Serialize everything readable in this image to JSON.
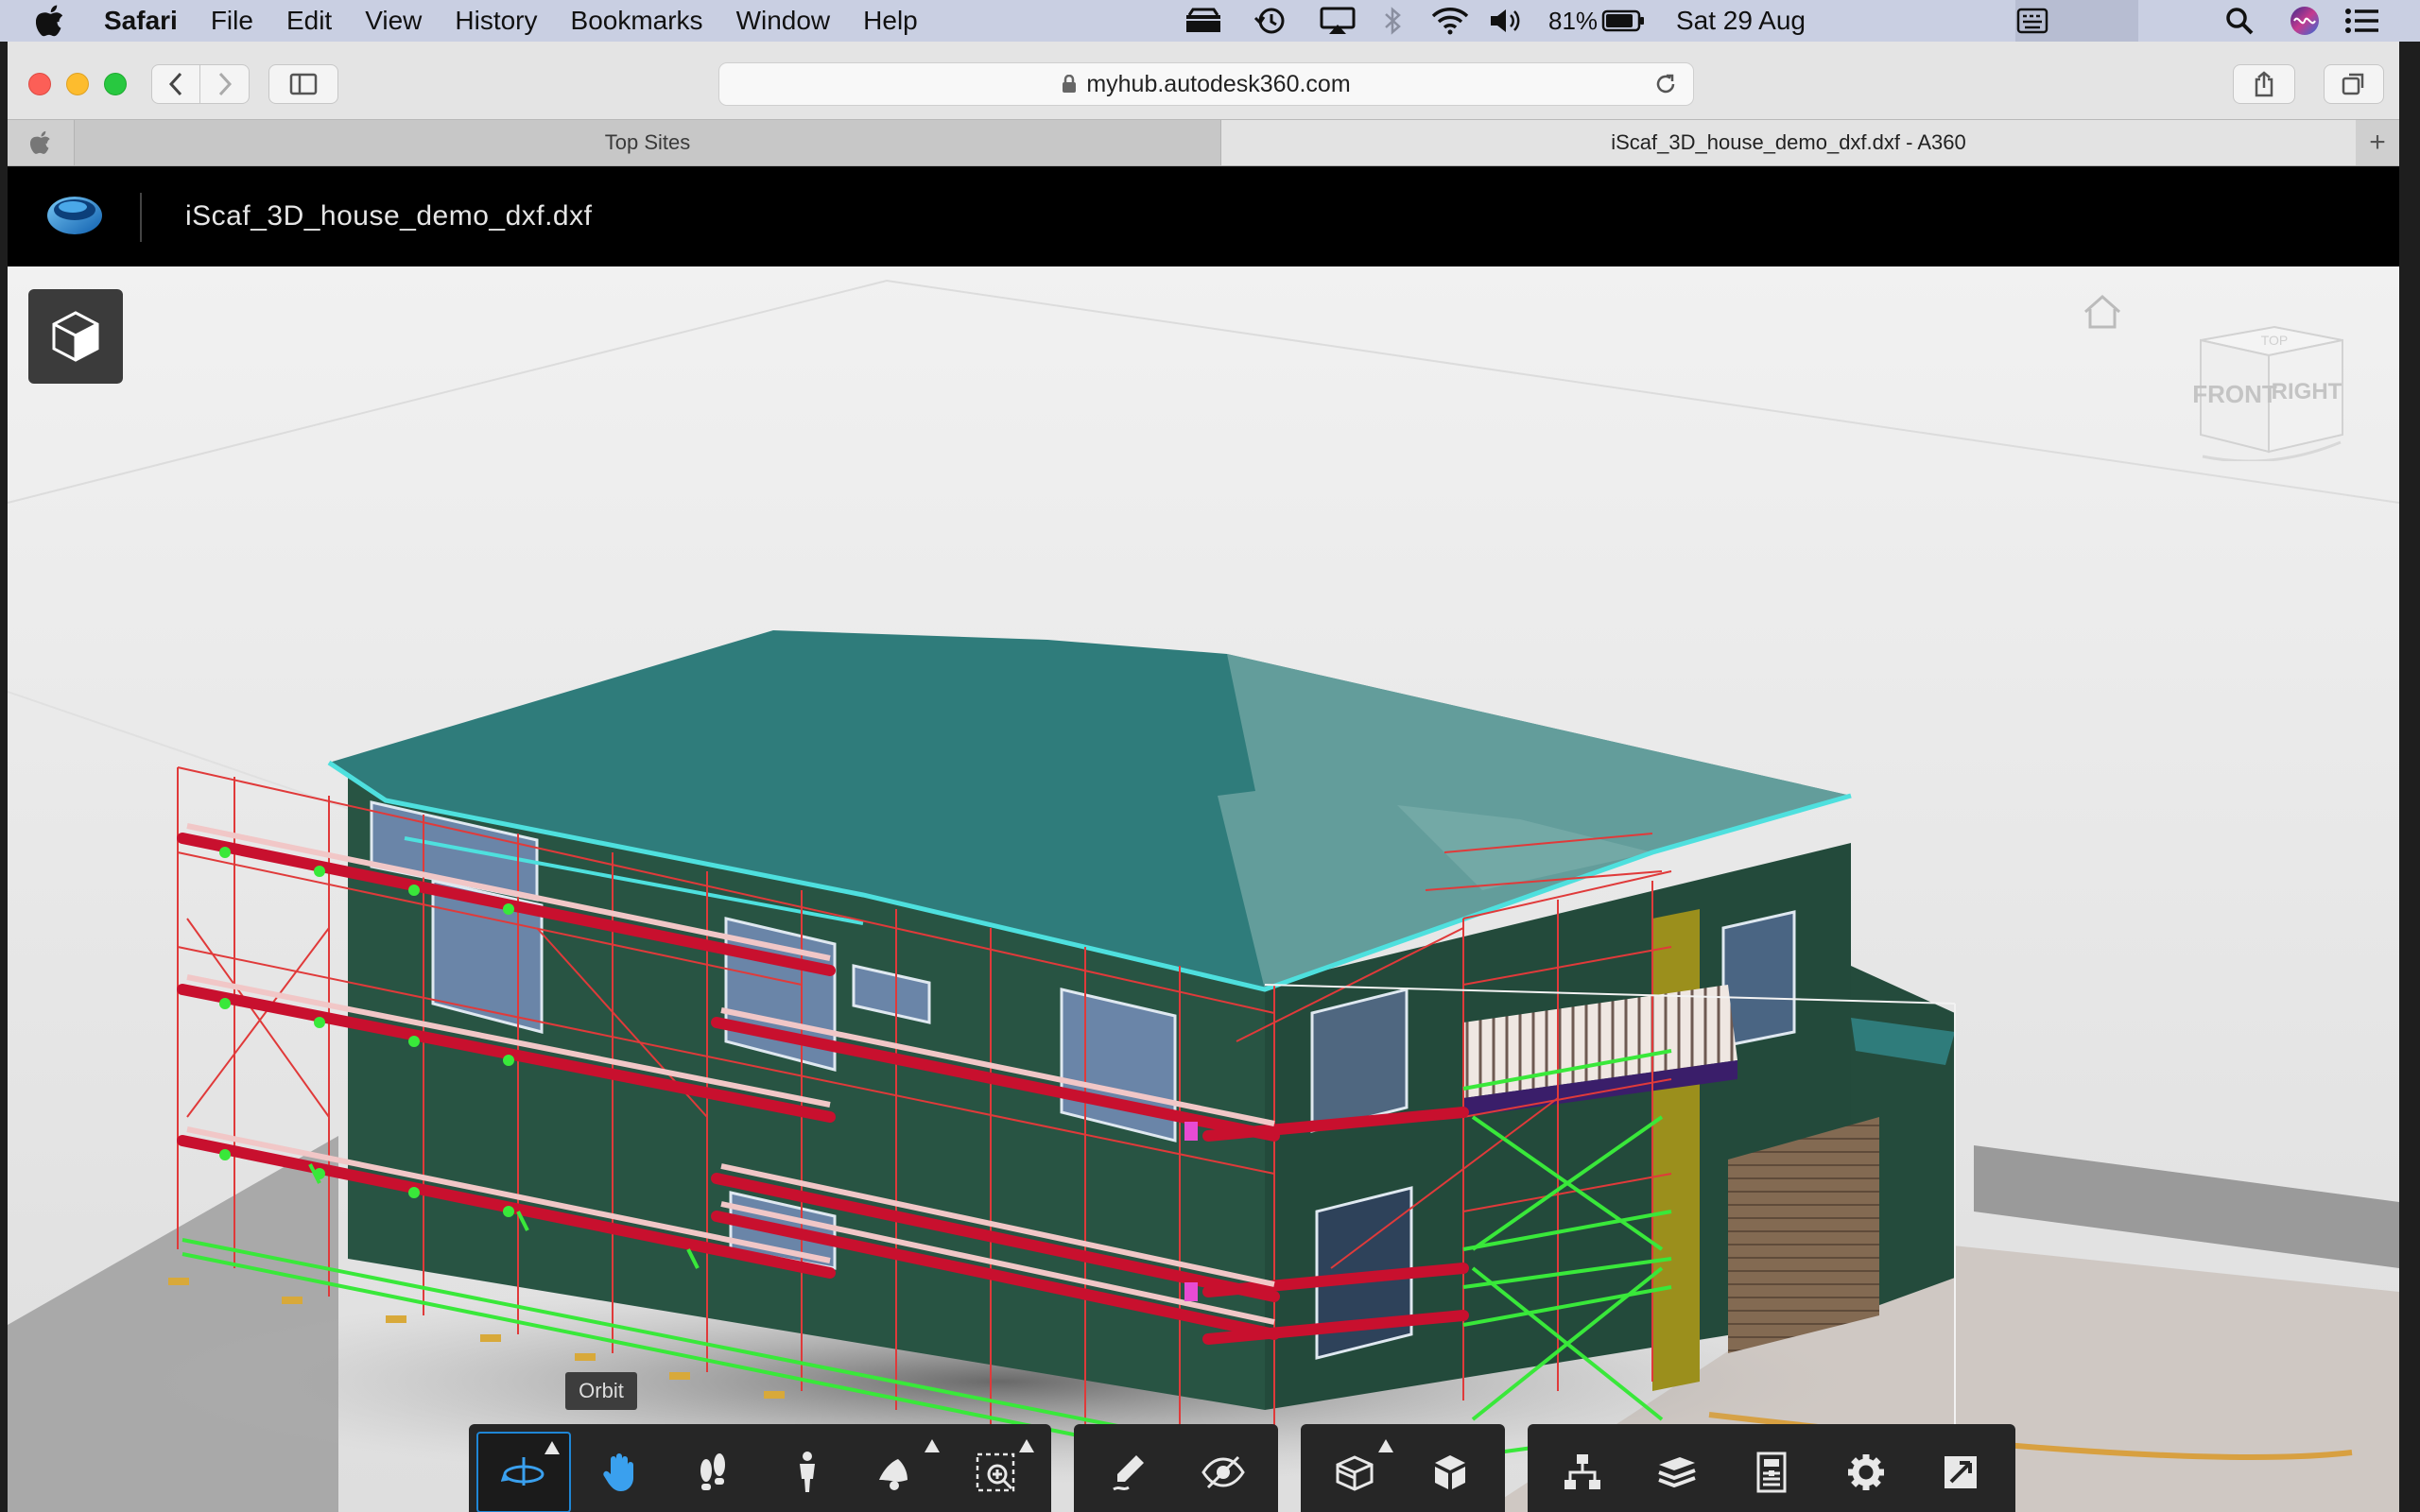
{
  "menubar": {
    "app_name": "Safari",
    "items": [
      "File",
      "Edit",
      "View",
      "History",
      "Bookmarks",
      "Window",
      "Help"
    ],
    "battery_percent": "81%",
    "date": "Sat 29 Aug"
  },
  "browser": {
    "url": "myhub.autodesk360.com",
    "tabs": [
      {
        "label": "Top Sites"
      },
      {
        "label": "iScaf_3D_house_demo_dxf.dxf - A360"
      }
    ],
    "new_tab_label": "+"
  },
  "viewer": {
    "file_title": "iScaf_3D_house_demo_dxf.dxf",
    "viewcube": {
      "front": "FRONT",
      "right": "RIGHT",
      "top": "TOP"
    },
    "tooltip": "Orbit",
    "toolbar_icons": [
      "orbit-icon",
      "pan-icon",
      "first-person-icon",
      "walk-icon",
      "zoom-icon",
      "fit-to-view-icon",
      "markup-icon",
      "hide-icon",
      "section-icon",
      "explode-icon",
      "model-browser-icon",
      "layers-icon",
      "properties-icon",
      "settings-icon",
      "fullscreen-icon"
    ]
  },
  "colors": {
    "menubar_bg": "#c9cfe2",
    "roof": "#2f7c7b",
    "wall": "#285443",
    "scaffold_red": "#e0202a",
    "scaffold_green": "#39e83a",
    "accent_blue": "#1f86d6"
  }
}
